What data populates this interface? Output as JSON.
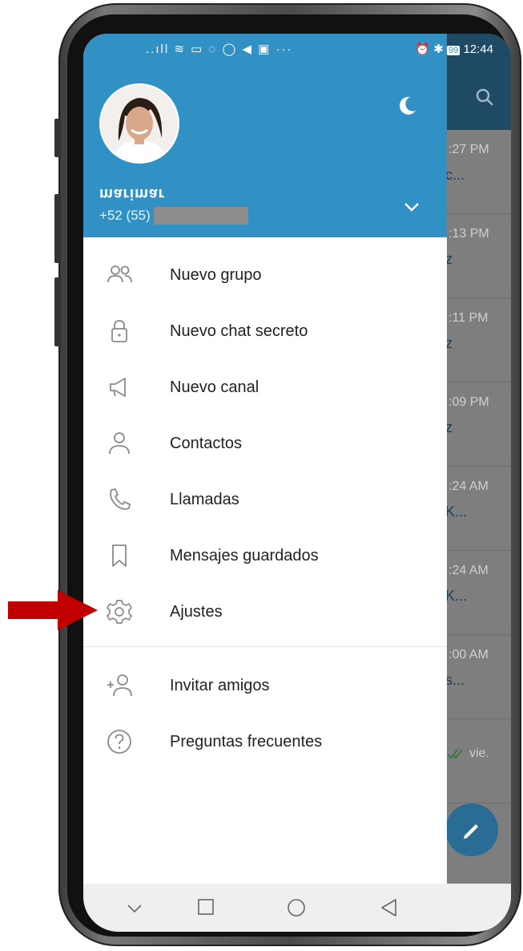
{
  "status_bar": {
    "left_icons": "..ıll ≋ ▭ ◌ ◯ ◀ ▣ ···",
    "time": "12:44",
    "battery": "99"
  },
  "drawer": {
    "username": "marimar",
    "phone_prefix": "+52 (55)",
    "menu": [
      {
        "label": "Nuevo grupo",
        "icon": "group-icon"
      },
      {
        "label": "Nuevo chat secreto",
        "icon": "lock-icon"
      },
      {
        "label": "Nuevo canal",
        "icon": "megaphone-icon"
      },
      {
        "label": "Contactos",
        "icon": "person-icon"
      },
      {
        "label": "Llamadas",
        "icon": "phone-icon"
      },
      {
        "label": "Mensajes guardados",
        "icon": "bookmark-icon"
      },
      {
        "label": "Ajustes",
        "icon": "gear-icon"
      }
    ],
    "secondary_menu": [
      {
        "label": "Invitar amigos",
        "icon": "add-person-icon"
      },
      {
        "label": "Preguntas frecuentes",
        "icon": "question-icon"
      }
    ]
  },
  "chat_list": [
    {
      "time": ":27 PM",
      "text": "c..."
    },
    {
      "time": ":13 PM",
      "text": "z"
    },
    {
      "time": ":11 PM",
      "text": "z"
    },
    {
      "time": ":09 PM",
      "text": "z"
    },
    {
      "time": ":24 AM",
      "text": "K..."
    },
    {
      "time": ":24 AM",
      "text": "K..."
    },
    {
      "time": ":00 AM",
      "text": "s..."
    },
    {
      "time": "vie.",
      "text": ""
    }
  ],
  "colors": {
    "header": "#3190c4",
    "arrow": "#c00000"
  }
}
